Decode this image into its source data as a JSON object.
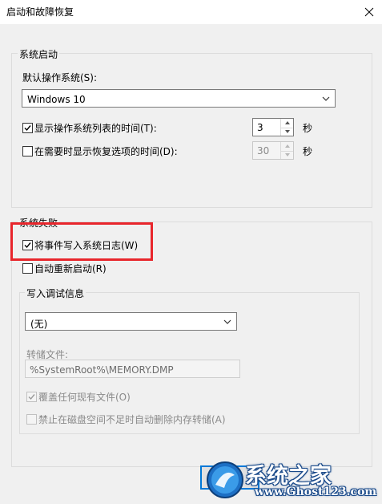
{
  "window": {
    "title": "启动和故障恢复"
  },
  "system_startup": {
    "group_label": "系统启动",
    "default_os_label": "默认操作系统(S):",
    "default_os_value": "Windows 10",
    "show_list_label": "显示操作系统列表的时间(T):",
    "show_list_checked": true,
    "show_list_value": "3",
    "show_list_unit": "秒",
    "show_recovery_label": "在需要时显示恢复选项的时间(D):",
    "show_recovery_checked": false,
    "show_recovery_value": "30",
    "show_recovery_unit": "秒"
  },
  "system_failure": {
    "group_label": "系统失败",
    "write_event_label": "将事件写入系统日志(W)",
    "write_event_checked": true,
    "auto_restart_label": "自动重新启动(R)",
    "auto_restart_checked": false
  },
  "debug_info": {
    "group_label": "写入调试信息",
    "dump_type_value": "(无)",
    "dump_file_label": "转储文件:",
    "dump_file_value": "%SystemRoot%\\MEMORY.DMP",
    "overwrite_label": "覆盖任何现有文件(O)",
    "overwrite_checked": true,
    "disable_autodelete_label": "禁止在磁盘空间不足时自动删除内存转储(A)",
    "disable_autodelete_checked": false
  },
  "buttons": {
    "ok_label": "确"
  },
  "watermark": {
    "site_name": "系统之家",
    "url": "www.Ghost123.com"
  },
  "colors": {
    "highlight": "#e8262c",
    "focus": "#0078d7"
  }
}
